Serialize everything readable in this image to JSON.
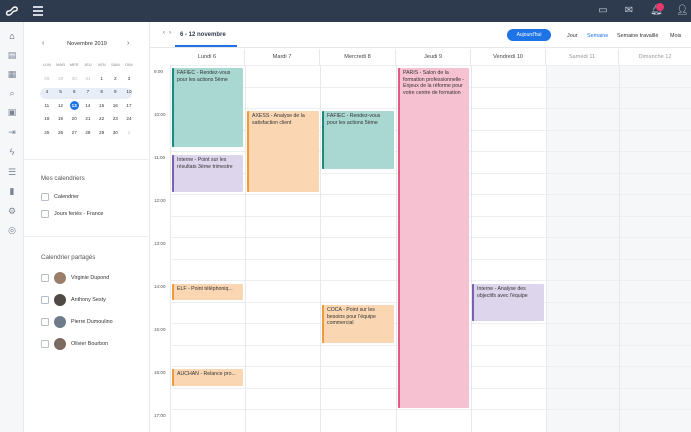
{
  "app": {
    "logo_icon": "logo-icon"
  },
  "topbar": {
    "icons": [
      "menu-icon",
      "window-icon",
      "chat-icon",
      "bell-icon",
      "user-icon"
    ],
    "accent": "#2e3a4e",
    "notif_color": "#e8396b"
  },
  "leftnav": {
    "icons": [
      "home-icon",
      "document-icon",
      "grid-icon",
      "search-icon",
      "calendar-icon",
      "export-icon",
      "flash-icon",
      "list-icon",
      "chart-icon",
      "settings-icon",
      "database-icon"
    ]
  },
  "mini_calendar": {
    "title": "Novembre 2019",
    "days_of_week": [
      "LUN",
      "MAR",
      "MER",
      "JEU",
      "VEN",
      "SAM",
      "DIM"
    ],
    "weeks": [
      [
        "28",
        "29",
        "30",
        "31",
        "1",
        "2",
        "3"
      ],
      [
        "4",
        "5",
        "6",
        "7",
        "8",
        "9",
        "10"
      ],
      [
        "11",
        "12",
        "13",
        "14",
        "15",
        "16",
        "17"
      ],
      [
        "18",
        "19",
        "20",
        "21",
        "22",
        "23",
        "24"
      ],
      [
        "25",
        "26",
        "27",
        "28",
        "29",
        "30",
        "1"
      ]
    ],
    "today": "13"
  },
  "my_calendars": {
    "heading": "Mes calendriers",
    "items": [
      "Calendrier",
      "Jours feriés - France"
    ]
  },
  "shared_calendars": {
    "heading": "Calendrier partagés",
    "items": [
      "Virginie Dupond",
      "Anthony Sesty",
      "Pierre Dumoulino",
      "Olivier Bourbon"
    ]
  },
  "toolbar": {
    "range": "6 - 12 novembre",
    "today_label": "Aujourd'hui",
    "views": [
      "Jour",
      "Semaine",
      "Semaine travaillé",
      "Mois"
    ],
    "active_view": "Semaine",
    "accent": "#1e74e6"
  },
  "days": [
    "Lundi 6",
    "Mardi 7",
    "Mercredi 8",
    "Jeudi 9",
    "Vendredi 10",
    "Samedi 11",
    "Dimanche 12"
  ],
  "hours": [
    "9:00",
    "10:00",
    "11:00",
    "12:00",
    "13:00",
    "14:00",
    "15:00",
    "16:00",
    "17:00"
  ],
  "events": [
    {
      "day": 0,
      "title": "FAFIEC - Rendez-vous pour les actions 5ème",
      "color": "teal"
    },
    {
      "day": 0,
      "title": "Interne - Point sur les résultats 3ème trimestre",
      "color": "purple"
    },
    {
      "day": 0,
      "title": "ELF - Point téléphoniq...",
      "color": "orange"
    },
    {
      "day": 0,
      "title": "AUCHAN - Relance pro...",
      "color": "orange"
    },
    {
      "day": 1,
      "title": "AXESS - Analyse de la satisfaction client",
      "color": "orange"
    },
    {
      "day": 2,
      "title": "FAFIEC - Rendez-vous pour les actions 5ème",
      "color": "teal"
    },
    {
      "day": 2,
      "title": "COCA - Point sur les besoins pour l'équipe commercial",
      "color": "orange"
    },
    {
      "day": 3,
      "title": "PARIS - Salon de la formation professionnelle - Enjeux de la réforme pour votre centre de formation",
      "color": "pink"
    },
    {
      "day": 4,
      "title": "Interne - Analyse des objectifs avec l'équipe",
      "color": "purple"
    }
  ]
}
